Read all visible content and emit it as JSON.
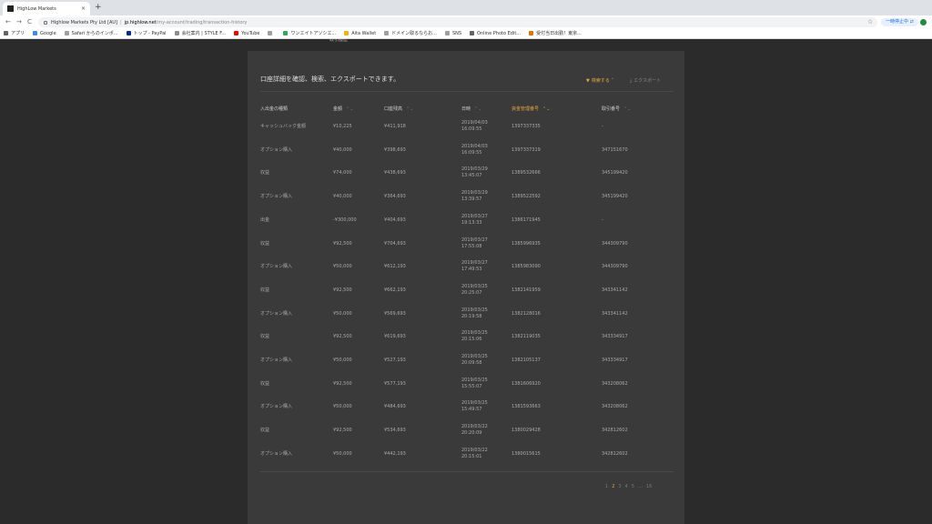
{
  "browser": {
    "tab_title": "HighLow Markets",
    "tab_close": "×",
    "new_tab": "+",
    "nav_back": "←",
    "nav_forward": "→",
    "nav_reload": "C",
    "site_name": "Highlow Markets Pty Ltd [AU]",
    "url_domain": "jp.highlow.net",
    "url_path": "/my-account/trading/transaction-history",
    "star": "☆",
    "sleep_label": "一時停止中 ⇄",
    "bookmarks": [
      {
        "label": "アプリ",
        "color": "#5f6368"
      },
      {
        "label": "Google",
        "color": "#4285f4"
      },
      {
        "label": "Safari からのインポ...",
        "color": "#9aa0a6"
      },
      {
        "label": "トップ - PayPal",
        "color": "#003087"
      },
      {
        "label": "会社案内 | STYLE F...",
        "color": "#8c8c8c"
      },
      {
        "label": "YouTube",
        "color": "#ff0000"
      },
      {
        "label": "",
        "color": "#9aa0a6"
      },
      {
        "label": "ワンエイトアソシエ...",
        "color": "#34a853"
      },
      {
        "label": "Aita Wallet",
        "color": "#f4b400"
      },
      {
        "label": "ドメイン取るならお...",
        "color": "#9aa0a6"
      },
      {
        "label": "SNS",
        "color": "#9aa0a6"
      },
      {
        "label": "Online Photo Edit...",
        "color": "#5f6368"
      },
      {
        "label": "受付当日出勤！東京...",
        "color": "#e37400"
      }
    ]
  },
  "page": {
    "top_tab_fragment": "取引履歴",
    "heading": "口座詳細を確認、検索、エクスポートできます。",
    "search_label": "検索する",
    "export_label": "エクスポート",
    "accent_color": "#e5a53a"
  },
  "table": {
    "headers": [
      "入出金の種類",
      "金額",
      "口座残高",
      "日時",
      "資金管理番号",
      "取引番号"
    ],
    "sort_glyph": "⌃⌄",
    "rows": [
      {
        "type": "キャッシュバック金額",
        "amount": "¥10,225",
        "balance": "¥411,918",
        "date": "2019/04/03",
        "time": "16:09:55",
        "fund_id": "1397337335",
        "trade_id": "-"
      },
      {
        "type": "オプション購入",
        "amount": "¥40,000",
        "balance": "¥398,693",
        "date": "2019/04/03",
        "time": "16:09:55",
        "fund_id": "1397337319",
        "trade_id": "347151670"
      },
      {
        "type": "収益",
        "amount": "¥74,000",
        "balance": "¥438,693",
        "date": "2019/03/29",
        "time": "13:45:07",
        "fund_id": "1389532666",
        "trade_id": "345199420"
      },
      {
        "type": "オプション購入",
        "amount": "¥40,000",
        "balance": "¥364,693",
        "date": "2019/03/29",
        "time": "13:39:57",
        "fund_id": "1389522592",
        "trade_id": "345199420"
      },
      {
        "type": "出金",
        "amount": "-¥300,000",
        "balance": "¥404,693",
        "date": "2019/03/27",
        "time": "19:13:33",
        "fund_id": "1386171945",
        "trade_id": "-"
      },
      {
        "type": "収益",
        "amount": "¥92,500",
        "balance": "¥704,693",
        "date": "2019/03/27",
        "time": "17:55:08",
        "fund_id": "1385996935",
        "trade_id": "344309790"
      },
      {
        "type": "オプション購入",
        "amount": "¥50,000",
        "balance": "¥612,193",
        "date": "2019/03/27",
        "time": "17:49:53",
        "fund_id": "1385983090",
        "trade_id": "344309790"
      },
      {
        "type": "収益",
        "amount": "¥92,500",
        "balance": "¥662,193",
        "date": "2019/03/25",
        "time": "20:25:07",
        "fund_id": "1382141959",
        "trade_id": "343341142"
      },
      {
        "type": "オプション購入",
        "amount": "¥50,000",
        "balance": "¥569,693",
        "date": "2019/03/25",
        "time": "20:19:58",
        "fund_id": "1382128016",
        "trade_id": "343341142"
      },
      {
        "type": "収益",
        "amount": "¥92,500",
        "balance": "¥619,693",
        "date": "2019/03/25",
        "time": "20:15:06",
        "fund_id": "1382119035",
        "trade_id": "343334917"
      },
      {
        "type": "オプション購入",
        "amount": "¥50,000",
        "balance": "¥527,193",
        "date": "2019/03/25",
        "time": "20:09:58",
        "fund_id": "1382105137",
        "trade_id": "343334917"
      },
      {
        "type": "収益",
        "amount": "¥92,500",
        "balance": "¥577,193",
        "date": "2019/03/25",
        "time": "15:55:07",
        "fund_id": "1381606920",
        "trade_id": "343208062"
      },
      {
        "type": "オプション購入",
        "amount": "¥50,000",
        "balance": "¥484,693",
        "date": "2019/03/25",
        "time": "15:49:57",
        "fund_id": "1381593663",
        "trade_id": "343208062"
      },
      {
        "type": "収益",
        "amount": "¥92,500",
        "balance": "¥534,693",
        "date": "2019/03/22",
        "time": "20:20:09",
        "fund_id": "1380029428",
        "trade_id": "342812602"
      },
      {
        "type": "オプション購入",
        "amount": "¥50,000",
        "balance": "¥442,193",
        "date": "2019/03/22",
        "time": "20:15:01",
        "fund_id": "1380015615",
        "trade_id": "342812602"
      }
    ]
  },
  "pagination": {
    "items": [
      "1",
      "2",
      "3",
      "4",
      "5",
      "…",
      "16"
    ],
    "current": "2"
  }
}
